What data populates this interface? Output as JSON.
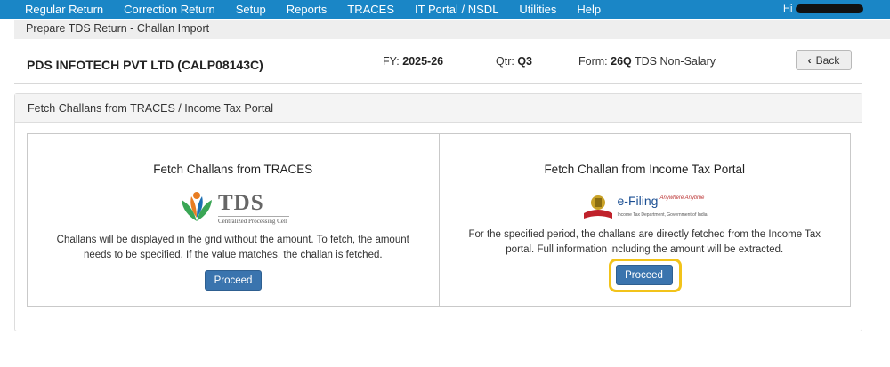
{
  "nav": {
    "items": [
      "Regular Return",
      "Correction Return",
      "Setup",
      "Reports",
      "TRACES",
      "IT Portal / NSDL",
      "Utilities",
      "Help"
    ],
    "user": "Hi"
  },
  "breadcrumb": "Prepare TDS Return - Challan Import",
  "info": {
    "company": "PDS INFOTECH PVT LTD (CALP08143C)",
    "fy_label": "FY:",
    "fy_value": "2025-26",
    "qtr_label": "Qtr:",
    "qtr_value": "Q3",
    "form_label": "Form:",
    "form_value": "26Q",
    "form_desc": "TDS Non-Salary",
    "back_label": "Back"
  },
  "panel": {
    "title": "Fetch Challans from TRACES / Income Tax Portal",
    "traces": {
      "title": "Fetch Challans from TRACES",
      "logo_text": "TDS",
      "logo_sub": "Centralized Processing Cell",
      "description": "Challans will be displayed in the grid without the amount. To fetch, the amount needs to be specified. If the value matches, the challan is fetched.",
      "button": "Proceed"
    },
    "portal": {
      "title": "Fetch Challan from Income Tax Portal",
      "logo_text": "e-Filing",
      "logo_tag": "Anywhere Anytime",
      "logo_sub": "Income Tax Department, Government of India",
      "description": "For the specified period, the challans are directly fetched from the Income Tax portal. Full information including the amount will be extracted.",
      "button": "Proceed"
    }
  },
  "colors": {
    "nav_bg": "#1a86c6",
    "button_bg": "#3a74ae",
    "highlight": "#f2c31a"
  }
}
